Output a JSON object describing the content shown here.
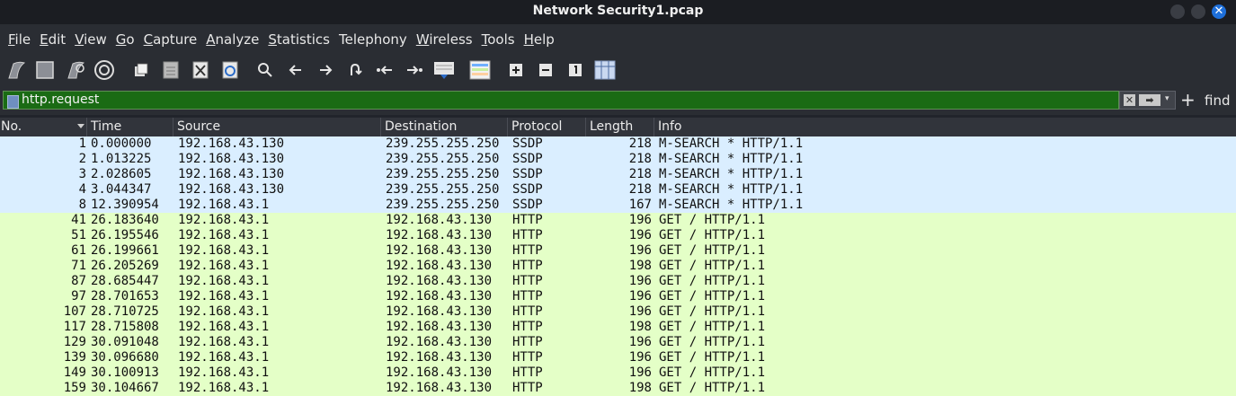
{
  "window": {
    "title": "Network Security1.pcap"
  },
  "menu": [
    {
      "label": "File",
      "u": "F",
      "rest": "ile"
    },
    {
      "label": "Edit",
      "u": "E",
      "rest": "dit"
    },
    {
      "label": "View",
      "u": "V",
      "rest": "iew"
    },
    {
      "label": "Go",
      "u": "G",
      "rest": "o"
    },
    {
      "label": "Capture",
      "u": "C",
      "rest": "apture"
    },
    {
      "label": "Analyze",
      "u": "A",
      "rest": "nalyze"
    },
    {
      "label": "Statistics",
      "u": "S",
      "rest": "tatistics"
    },
    {
      "label": "Telephony",
      "u": "",
      "rest": "Telephony"
    },
    {
      "label": "Wireless",
      "u": "W",
      "rest": "ireless"
    },
    {
      "label": "Tools",
      "u": "T",
      "rest": "ools"
    },
    {
      "label": "Help",
      "u": "H",
      "rest": "elp"
    }
  ],
  "toolbar": [
    "start-capture-icon",
    "stop-capture-icon",
    "restart-capture-icon",
    "capture-options-icon",
    "open-file-icon",
    "save-file-icon",
    "close-file-icon",
    "reload-file-icon",
    "find-packet-icon",
    "go-back-icon",
    "go-forward-icon",
    "go-to-packet-icon",
    "first-packet-icon",
    "last-packet-icon",
    "autoscroll-icon",
    "colorize-icon",
    "zoom-in-icon",
    "zoom-out-icon",
    "normal-size-icon",
    "resize-columns-icon"
  ],
  "filter": {
    "value": "http.request",
    "find_label": "find",
    "add_label": "+",
    "clear_glyph": "✕",
    "apply_glyph": "➡",
    "dropdown_glyph": "▾"
  },
  "columns": [
    "No.",
    "Time",
    "Source",
    "Destination",
    "Protocol",
    "Length",
    "Info"
  ],
  "packets": [
    {
      "no": "1",
      "time": "0.000000",
      "src": "192.168.43.130",
      "dst": "239.255.255.250",
      "proto": "SSDP",
      "len": "218",
      "info": "M-SEARCH * HTTP/1.1"
    },
    {
      "no": "2",
      "time": "1.013225",
      "src": "192.168.43.130",
      "dst": "239.255.255.250",
      "proto": "SSDP",
      "len": "218",
      "info": "M-SEARCH * HTTP/1.1"
    },
    {
      "no": "3",
      "time": "2.028605",
      "src": "192.168.43.130",
      "dst": "239.255.255.250",
      "proto": "SSDP",
      "len": "218",
      "info": "M-SEARCH * HTTP/1.1"
    },
    {
      "no": "4",
      "time": "3.044347",
      "src": "192.168.43.130",
      "dst": "239.255.255.250",
      "proto": "SSDP",
      "len": "218",
      "info": "M-SEARCH * HTTP/1.1"
    },
    {
      "no": "8",
      "time": "12.390954",
      "src": "192.168.43.1",
      "dst": "239.255.255.250",
      "proto": "SSDP",
      "len": "167",
      "info": "M-SEARCH * HTTP/1.1"
    },
    {
      "no": "41",
      "time": "26.183640",
      "src": "192.168.43.1",
      "dst": "192.168.43.130",
      "proto": "HTTP",
      "len": "196",
      "info": "GET / HTTP/1.1"
    },
    {
      "no": "51",
      "time": "26.195546",
      "src": "192.168.43.1",
      "dst": "192.168.43.130",
      "proto": "HTTP",
      "len": "196",
      "info": "GET / HTTP/1.1"
    },
    {
      "no": "61",
      "time": "26.199661",
      "src": "192.168.43.1",
      "dst": "192.168.43.130",
      "proto": "HTTP",
      "len": "196",
      "info": "GET / HTTP/1.1"
    },
    {
      "no": "71",
      "time": "26.205269",
      "src": "192.168.43.1",
      "dst": "192.168.43.130",
      "proto": "HTTP",
      "len": "198",
      "info": "GET / HTTP/1.1"
    },
    {
      "no": "87",
      "time": "28.685447",
      "src": "192.168.43.1",
      "dst": "192.168.43.130",
      "proto": "HTTP",
      "len": "196",
      "info": "GET / HTTP/1.1"
    },
    {
      "no": "97",
      "time": "28.701653",
      "src": "192.168.43.1",
      "dst": "192.168.43.130",
      "proto": "HTTP",
      "len": "196",
      "info": "GET / HTTP/1.1"
    },
    {
      "no": "107",
      "time": "28.710725",
      "src": "192.168.43.1",
      "dst": "192.168.43.130",
      "proto": "HTTP",
      "len": "196",
      "info": "GET / HTTP/1.1"
    },
    {
      "no": "117",
      "time": "28.715808",
      "src": "192.168.43.1",
      "dst": "192.168.43.130",
      "proto": "HTTP",
      "len": "198",
      "info": "GET / HTTP/1.1"
    },
    {
      "no": "129",
      "time": "30.091048",
      "src": "192.168.43.1",
      "dst": "192.168.43.130",
      "proto": "HTTP",
      "len": "196",
      "info": "GET / HTTP/1.1"
    },
    {
      "no": "139",
      "time": "30.096680",
      "src": "192.168.43.1",
      "dst": "192.168.43.130",
      "proto": "HTTP",
      "len": "196",
      "info": "GET / HTTP/1.1"
    },
    {
      "no": "149",
      "time": "30.100913",
      "src": "192.168.43.1",
      "dst": "192.168.43.130",
      "proto": "HTTP",
      "len": "196",
      "info": "GET / HTTP/1.1"
    },
    {
      "no": "159",
      "time": "30.104667",
      "src": "192.168.43.1",
      "dst": "192.168.43.130",
      "proto": "HTTP",
      "len": "198",
      "info": "GET / HTTP/1.1"
    }
  ],
  "colors": {
    "ssdp_row": "#daeeff",
    "http_row": "#e4ffc7",
    "filter_valid": "#1a6b14",
    "close_button": "#1e6fd9"
  }
}
